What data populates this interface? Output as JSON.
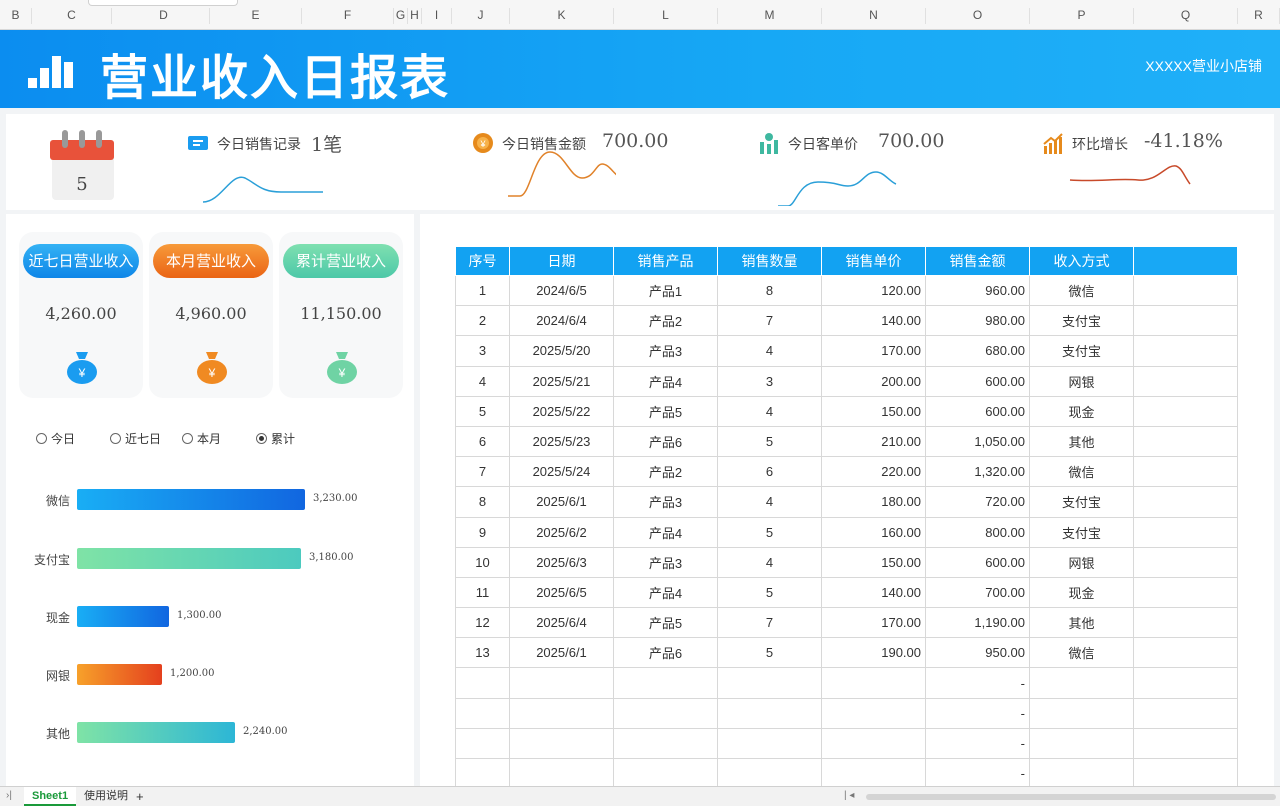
{
  "columns": [
    "B",
    "C",
    "D",
    "E",
    "F",
    "G",
    "H",
    "I",
    "J",
    "K",
    "L",
    "M",
    "N",
    "O",
    "P",
    "Q",
    "R"
  ],
  "banner": {
    "title": "营业收入日报表",
    "shop_name": "XXXXX营业小店铺"
  },
  "calendar": {
    "day": "5"
  },
  "kpis": [
    {
      "label": "今日销售记录",
      "value": "1笔",
      "icon": "ticket-icon"
    },
    {
      "label": "今日销售金额",
      "value": "700.00",
      "icon": "coin-icon"
    },
    {
      "label": "今日客单价",
      "value": "700.00",
      "icon": "people-chart-icon"
    },
    {
      "label": "环比增长",
      "value": "-41.18%",
      "icon": "growth-chart-icon"
    }
  ],
  "cards": [
    {
      "label": "近七日营业收入",
      "amount": "4,260.00",
      "color": "#1a9cf0"
    },
    {
      "label": "本月营业收入",
      "amount": "4,960.00",
      "color": "#f07a22"
    },
    {
      "label": "累计营业收入",
      "amount": "11,150.00",
      "color": "#6fd8a8"
    }
  ],
  "filters": [
    {
      "label": "今日",
      "selected": false
    },
    {
      "label": "近七日",
      "selected": false
    },
    {
      "label": "本月",
      "selected": false
    },
    {
      "label": "累计",
      "selected": true
    }
  ],
  "chart_data": {
    "type": "bar",
    "orientation": "horizontal",
    "title": "",
    "categories": [
      "微信",
      "支付宝",
      "现金",
      "网银",
      "其他"
    ],
    "values": [
      3230,
      3180,
      1300,
      1200,
      2240
    ],
    "value_labels": [
      "3,230.00",
      "3,180.00",
      "1,300.00",
      "1,200.00",
      "2,240.00"
    ],
    "xlim": [
      0,
      3400
    ],
    "grid": false
  },
  "table": {
    "headers": [
      "序号",
      "日期",
      "销售产品",
      "销售数量",
      "销售单价",
      "销售金额",
      "收入方式",
      ""
    ],
    "rows": [
      [
        "1",
        "2024/6/5",
        "产品1",
        "8",
        "120.00",
        "960.00",
        "微信",
        ""
      ],
      [
        "2",
        "2024/6/4",
        "产品2",
        "7",
        "140.00",
        "980.00",
        "支付宝",
        ""
      ],
      [
        "3",
        "2025/5/20",
        "产品3",
        "4",
        "170.00",
        "680.00",
        "支付宝",
        ""
      ],
      [
        "4",
        "2025/5/21",
        "产品4",
        "3",
        "200.00",
        "600.00",
        "网银",
        ""
      ],
      [
        "5",
        "2025/5/22",
        "产品5",
        "4",
        "150.00",
        "600.00",
        "现金",
        ""
      ],
      [
        "6",
        "2025/5/23",
        "产品6",
        "5",
        "210.00",
        "1,050.00",
        "其他",
        ""
      ],
      [
        "7",
        "2025/5/24",
        "产品2",
        "6",
        "220.00",
        "1,320.00",
        "微信",
        ""
      ],
      [
        "8",
        "2025/6/1",
        "产品3",
        "4",
        "180.00",
        "720.00",
        "支付宝",
        ""
      ],
      [
        "9",
        "2025/6/2",
        "产品4",
        "5",
        "160.00",
        "800.00",
        "支付宝",
        ""
      ],
      [
        "10",
        "2025/6/3",
        "产品3",
        "4",
        "150.00",
        "600.00",
        "网银",
        ""
      ],
      [
        "11",
        "2025/6/5",
        "产品4",
        "5",
        "140.00",
        "700.00",
        "现金",
        ""
      ],
      [
        "12",
        "2025/6/4",
        "产品5",
        "7",
        "170.00",
        "1,190.00",
        "其他",
        ""
      ],
      [
        "13",
        "2025/6/1",
        "产品6",
        "5",
        "190.00",
        "950.00",
        "微信",
        ""
      ],
      [
        "",
        "",
        "",
        "",
        "",
        "-",
        "",
        ""
      ],
      [
        "",
        "",
        "",
        "",
        "",
        "-",
        "",
        ""
      ],
      [
        "",
        "",
        "",
        "",
        "",
        "-",
        "",
        ""
      ],
      [
        "",
        "",
        "",
        "",
        "",
        "-",
        "",
        ""
      ]
    ]
  },
  "sheets": {
    "active": "Sheet1",
    "other": "使用说明",
    "add": "+"
  }
}
